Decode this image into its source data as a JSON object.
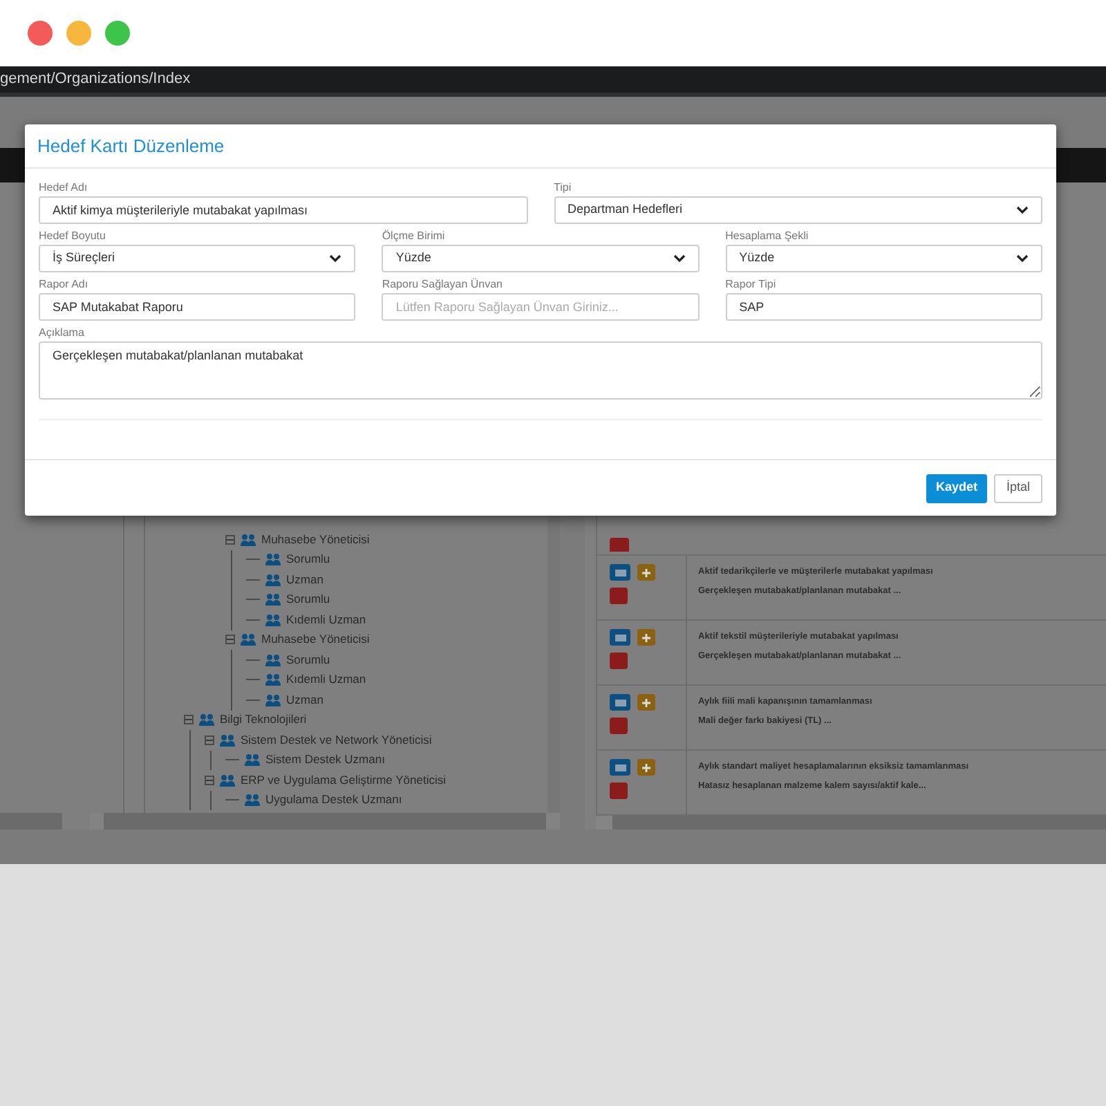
{
  "address_bar": {
    "url": "gement/Organizations/Index"
  },
  "tree": {
    "continued_branch": [
      {
        "label": "Muhasebe Yöneticisi",
        "expanded": true,
        "children": [
          {
            "label": "Sorumlu"
          },
          {
            "label": "Uzman"
          },
          {
            "label": "Sorumlu"
          },
          {
            "label": "Kıdemli Uzman"
          }
        ]
      },
      {
        "label": "Muhasebe Yöneticisi",
        "expanded": true,
        "children": [
          {
            "label": "Sorumlu"
          },
          {
            "label": "Kıdemli Uzman"
          },
          {
            "label": "Uzman"
          }
        ]
      }
    ],
    "nodes": [
      {
        "label": "Bilgi Teknolojileri",
        "expanded": true,
        "children": [
          {
            "label": "Sistem Destek ve Network Yöneticisi",
            "expanded": true,
            "children": [
              {
                "label": "Sistem Destek Uzmanı"
              }
            ]
          },
          {
            "label": "ERP ve Uygulama Geliştirme Yöneticisi",
            "expanded": true,
            "children": [
              {
                "label": "Uygulama Destek Uzmanı"
              }
            ]
          }
        ]
      }
    ]
  },
  "goals": [
    {
      "title": "Aktif tedarikçilerle ve müşterilerle mutabakat yapılması",
      "detail": "Gerçekleşen mutabakat/planlanan mutabakat ..."
    },
    {
      "title": "Aktif tekstil müşterileriyle mutabakat yapılması",
      "detail": "Gerçekleşen mutabakat/planlanan mutabakat ..."
    },
    {
      "title": "Aylık fiili mali kapanışının tamamlanması",
      "detail": "Mali değer farkı bakiyesi (TL) ..."
    },
    {
      "title": "Aylık standart maliyet hesaplamalarının eksiksiz tamamlanması",
      "detail": "Hatasız hesaplanan malzeme kalem sayısı/aktif kale..."
    }
  ],
  "modal": {
    "title": "Hedef Kartı Düzenleme",
    "rows": [
      [
        {
          "label": "Hedef Adı",
          "kind": "input",
          "value": "Aktif kimya müşterileriyle mutabakat yapılması"
        },
        {
          "label": "Tipi",
          "kind": "select",
          "value": "Departman Hedefleri"
        }
      ],
      [
        {
          "label": "Hedef Boyutu",
          "kind": "select",
          "value": "İş Süreçleri"
        },
        {
          "label": "Ölçme Birimi",
          "kind": "select",
          "value": "Yüzde"
        },
        {
          "label": "Hesaplama Şekli",
          "kind": "select",
          "value": "Yüzde"
        }
      ],
      [
        {
          "label": "Rapor Adı",
          "kind": "input",
          "value": "SAP Mutakabat Raporu"
        },
        {
          "label": "Raporu Sağlayan Ünvan",
          "kind": "input",
          "placeholder": "Lütfen Raporu Sağlayan Ünvan Giriniz..."
        },
        {
          "label": "Rapor Tipi",
          "kind": "input",
          "value": "SAP"
        }
      ]
    ],
    "description": {
      "label": "Açıklama",
      "value": "Gerçekleşen mutabakat/planlanan mutabakat"
    },
    "buttons": [
      {
        "label": "Kaydet",
        "kind": "primary"
      },
      {
        "label": "İptal",
        "kind": "default"
      }
    ]
  }
}
